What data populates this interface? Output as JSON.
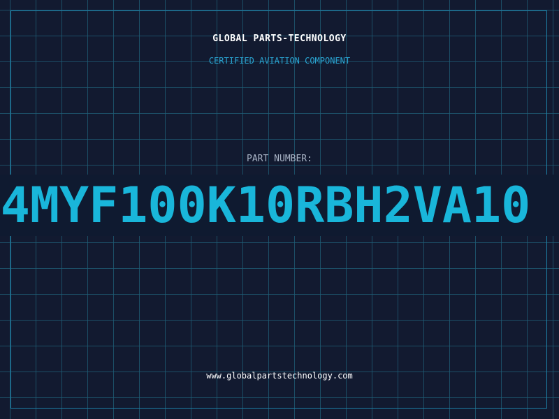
{
  "header": {
    "company": "GLOBAL PARTS-TECHNOLOGY",
    "subtitle": "CERTIFIED AVIATION COMPONENT"
  },
  "part": {
    "label": "PART NUMBER:",
    "number": "4MYF100K10RBH2VA10"
  },
  "footer": {
    "website": "www.globalpartstechnology.com"
  },
  "colors": {
    "background": "#121a30",
    "grid": "#1e5f78",
    "accent": "#19b6da",
    "text": "#ffffff"
  }
}
